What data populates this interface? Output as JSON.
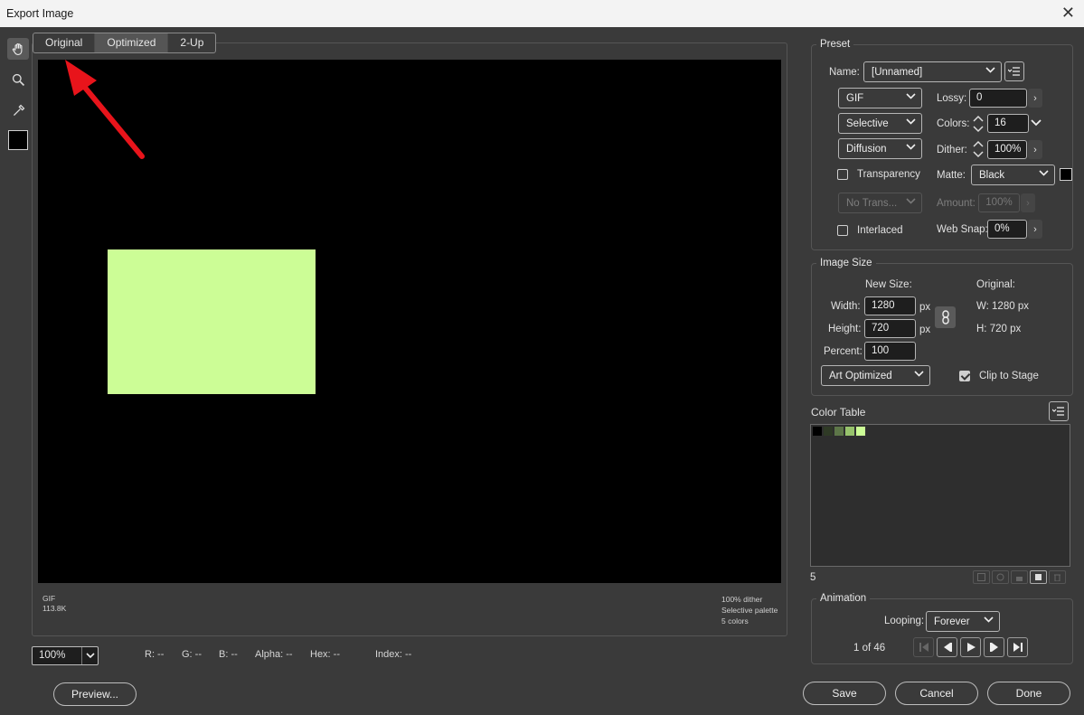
{
  "window": {
    "title": "Export Image",
    "close_glyph": "✕"
  },
  "tools": [
    "hand-icon",
    "zoom-icon",
    "eyedropper-icon",
    "color-swatch"
  ],
  "tabs": [
    "Original",
    "Optimized",
    "2-Up"
  ],
  "preview": {
    "info_left": [
      "GIF",
      "113.8K"
    ],
    "info_right": [
      "100% dither",
      "Selective palette",
      "5 colors"
    ]
  },
  "status": {
    "zoom": "100%",
    "r": "R:  --",
    "g": "G:  --",
    "b": "B:  --",
    "alpha": "Alpha:  --",
    "hex": "Hex:  --",
    "index": "Index:  --"
  },
  "preset": {
    "title": "Preset",
    "name_label": "Name:",
    "name_value": "[Unnamed]",
    "format": "GIF",
    "palette": "Selective",
    "dither_algo": "Diffusion",
    "transparency_label": "Transparency",
    "transparency_dither": "No Trans...",
    "interlaced_label": "Interlaced",
    "lossy_label": "Lossy:",
    "lossy_value": "0",
    "colors_label": "Colors:",
    "colors_value": "16",
    "dither_label": "Dither:",
    "dither_value": "100%",
    "matte_label": "Matte:",
    "matte_value": "Black",
    "amount_label": "Amount:",
    "amount_value": "100%",
    "websnap_label": "Web Snap:",
    "websnap_value": "0%"
  },
  "image_size": {
    "title": "Image Size",
    "new_size_label": "New Size:",
    "original_label": "Original:",
    "width_label": "Width:",
    "width_value": "1280",
    "width_unit": "px",
    "height_label": "Height:",
    "height_value": "720",
    "height_unit": "px",
    "percent_label": "Percent:",
    "percent_value": "100",
    "orig_w": "W:   1280 px",
    "orig_h": "H:   720 px",
    "quality": "Art Optimized",
    "clip_label": "Clip to Stage"
  },
  "color_table": {
    "title": "Color Table",
    "count": "5",
    "swatches": [
      "#000000",
      "#2f3a26",
      "#5d7648",
      "#97c36c",
      "#ccfd96"
    ]
  },
  "animation": {
    "title": "Animation",
    "looping_label": "Looping:",
    "looping_value": "Forever",
    "frame_text": "1 of 46"
  },
  "buttons": {
    "preview": "Preview...",
    "save": "Save",
    "cancel": "Cancel",
    "done": "Done"
  },
  "colors": {
    "arrow": "#e8141b",
    "accent_green": "#ccfd96"
  }
}
